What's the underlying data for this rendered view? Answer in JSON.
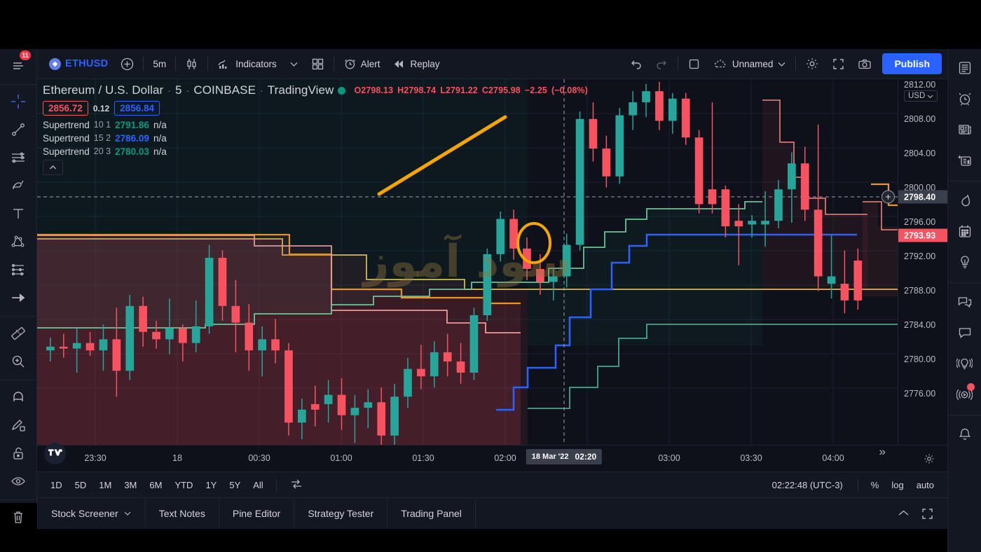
{
  "app": {
    "symbol": "ETHUSD",
    "timeframe": "5m",
    "indicators_label": "Indicators",
    "alert_label": "Alert",
    "replay_label": "Replay",
    "layout_name": "Unnamed",
    "publish_label": "Publish"
  },
  "legend": {
    "title": "Ethereum / U.S. Dollar",
    "interval": "5",
    "exchange": "COINBASE",
    "provider": "TradingView",
    "ohlc": {
      "o_label": "O",
      "o": "2798.13",
      "h_label": "H",
      "h": "2798.74",
      "l_label": "L",
      "l": "2791.22",
      "c_label": "C",
      "c": "2795.98",
      "change": "−2.25",
      "change_pct": "(−0.08%)"
    },
    "pricebox": {
      "bid": "2856.72",
      "spread": "0.12",
      "ask": "2856.84"
    },
    "indicators": [
      {
        "name": "Supertrend",
        "params": "10 1",
        "value": "2791.86",
        "value_color": "#089981",
        "extra": "n/a"
      },
      {
        "name": "Supertrend",
        "params": "15 2",
        "value": "2786.09",
        "value_color": "#2962ff",
        "extra": "n/a"
      },
      {
        "name": "Supertrend",
        "params": "20 3",
        "value": "2780.03",
        "value_color": "#089981",
        "extra": "n/a"
      }
    ]
  },
  "price_axis": {
    "currency": "USD",
    "ticks": [
      "2812.00",
      "2808.00",
      "2804.00",
      "2800.00",
      "2796.00",
      "2792.00",
      "2788.00",
      "2784.00",
      "2780.00",
      "2776.00"
    ],
    "last_price": "2793.93",
    "crosshair_price": "2798.40"
  },
  "time_axis": {
    "ticks": [
      "23:30",
      "18",
      "00:30",
      "01:00",
      "01:30",
      "02:00",
      "03:00",
      "03:30",
      "04:00"
    ],
    "crosshair_date": "18 Mar '22",
    "crosshair_time": "02:20"
  },
  "timeframes": [
    "1D",
    "5D",
    "1M",
    "3M",
    "6M",
    "YTD",
    "1Y",
    "5Y",
    "All"
  ],
  "bottom_bar": {
    "clock": "02:22:48 (UTC-3)",
    "percent": "%",
    "log": "log",
    "auto": "auto"
  },
  "panel_tabs": [
    "Stock Screener",
    "Text Notes",
    "Pine Editor",
    "Strategy Tester",
    "Trading Panel"
  ],
  "watermark": "سود آموز",
  "left_sidebar": {
    "badge": "11",
    "tools": [
      "watchlist-icon",
      "crosshair-icon",
      "trend-line-icon",
      "horizontal-lines-icon",
      "brush-icon",
      "text-icon",
      "patterns-icon",
      "forecast-icon",
      "arrow-icon",
      "measure-icon",
      "zoom-in-icon",
      "magnet-icon",
      "drawing-mode-icon",
      "lock-icon",
      "hide-drawings-icon",
      "trash-icon"
    ]
  },
  "right_sidebar": {
    "tools": [
      "watchlist-panel-icon",
      "alerts-icon",
      "news-icon",
      "data-window-icon",
      "hotlist-icon",
      "calendar-icon",
      "ideas-icon",
      "chat-icon",
      "private-chat-icon",
      "broadcast-icon",
      "stream-icon",
      "notifications-icon"
    ]
  },
  "chart_data": {
    "type": "candlestick",
    "title": "Ethereum / U.S. Dollar · 5 · COINBASE",
    "xlabel": "",
    "ylabel": "USD",
    "ylim": [
      2774.0,
      2813.5
    ],
    "grid": true,
    "up_color": "#26a69a",
    "down_color": "#f7525f",
    "candles": [
      {
        "t": "23:10",
        "o": 2784.2,
        "h": 2785.6,
        "l": 2783.0,
        "c": 2784.6,
        "dir": "up"
      },
      {
        "t": "23:15",
        "o": 2784.6,
        "h": 2786.0,
        "l": 2783.4,
        "c": 2784.4,
        "dir": "down"
      },
      {
        "t": "23:20",
        "o": 2784.4,
        "h": 2786.6,
        "l": 2781.8,
        "c": 2785.0,
        "dir": "up"
      },
      {
        "t": "23:25",
        "o": 2785.0,
        "h": 2786.2,
        "l": 2783.6,
        "c": 2784.2,
        "dir": "down"
      },
      {
        "t": "23:30",
        "o": 2784.2,
        "h": 2787.0,
        "l": 2782.0,
        "c": 2785.4,
        "dir": "up"
      },
      {
        "t": "23:35",
        "o": 2785.4,
        "h": 2788.8,
        "l": 2779.2,
        "c": 2782.0,
        "dir": "down"
      },
      {
        "t": "23:40",
        "o": 2782.0,
        "h": 2790.2,
        "l": 2781.0,
        "c": 2789.0,
        "dir": "up"
      },
      {
        "t": "23:45",
        "o": 2789.0,
        "h": 2790.0,
        "l": 2784.6,
        "c": 2786.2,
        "dir": "down"
      },
      {
        "t": "23:50",
        "o": 2786.2,
        "h": 2787.4,
        "l": 2784.4,
        "c": 2785.4,
        "dir": "down"
      },
      {
        "t": "23:55",
        "o": 2785.4,
        "h": 2789.8,
        "l": 2783.8,
        "c": 2786.6,
        "dir": "up"
      },
      {
        "t": "00:00",
        "o": 2786.6,
        "h": 2787.0,
        "l": 2783.0,
        "c": 2785.0,
        "dir": "down"
      },
      {
        "t": "00:05",
        "o": 2785.0,
        "h": 2789.6,
        "l": 2784.0,
        "c": 2786.8,
        "dir": "up"
      },
      {
        "t": "00:10",
        "o": 2786.8,
        "h": 2795.6,
        "l": 2786.0,
        "c": 2794.2,
        "dir": "up"
      },
      {
        "t": "00:15",
        "o": 2794.2,
        "h": 2795.0,
        "l": 2787.4,
        "c": 2789.0,
        "dir": "down"
      },
      {
        "t": "00:20",
        "o": 2789.0,
        "h": 2791.8,
        "l": 2784.0,
        "c": 2787.2,
        "dir": "down"
      },
      {
        "t": "00:25",
        "o": 2787.2,
        "h": 2789.2,
        "l": 2782.0,
        "c": 2784.2,
        "dir": "down"
      },
      {
        "t": "00:30",
        "o": 2784.2,
        "h": 2786.8,
        "l": 2781.4,
        "c": 2785.4,
        "dir": "up"
      },
      {
        "t": "00:35",
        "o": 2785.4,
        "h": 2787.6,
        "l": 2782.8,
        "c": 2784.2,
        "dir": "down"
      },
      {
        "t": "00:40",
        "o": 2784.2,
        "h": 2785.0,
        "l": 2775.0,
        "c": 2776.4,
        "dir": "down"
      },
      {
        "t": "00:45",
        "o": 2776.4,
        "h": 2779.0,
        "l": 2774.6,
        "c": 2777.8,
        "dir": "up"
      },
      {
        "t": "00:50",
        "o": 2777.8,
        "h": 2780.4,
        "l": 2776.0,
        "c": 2778.4,
        "dir": "down"
      },
      {
        "t": "00:55",
        "o": 2778.4,
        "h": 2781.0,
        "l": 2776.4,
        "c": 2779.4,
        "dir": "up"
      },
      {
        "t": "01:00",
        "o": 2779.4,
        "h": 2781.2,
        "l": 2775.6,
        "c": 2777.2,
        "dir": "down"
      },
      {
        "t": "01:05",
        "o": 2777.2,
        "h": 2779.4,
        "l": 2774.2,
        "c": 2778.0,
        "dir": "up"
      },
      {
        "t": "01:10",
        "o": 2778.0,
        "h": 2780.0,
        "l": 2775.8,
        "c": 2778.6,
        "dir": "up"
      },
      {
        "t": "01:15",
        "o": 2778.6,
        "h": 2780.2,
        "l": 2773.0,
        "c": 2775.0,
        "dir": "down"
      },
      {
        "t": "01:20",
        "o": 2775.0,
        "h": 2780.6,
        "l": 2774.0,
        "c": 2779.2,
        "dir": "up"
      },
      {
        "t": "01:25",
        "o": 2779.2,
        "h": 2783.4,
        "l": 2778.0,
        "c": 2782.2,
        "dir": "up"
      },
      {
        "t": "01:30",
        "o": 2782.2,
        "h": 2784.8,
        "l": 2780.0,
        "c": 2781.4,
        "dir": "down"
      },
      {
        "t": "01:35",
        "o": 2781.4,
        "h": 2785.2,
        "l": 2780.2,
        "c": 2784.0,
        "dir": "up"
      },
      {
        "t": "01:40",
        "o": 2784.0,
        "h": 2786.0,
        "l": 2781.4,
        "c": 2783.0,
        "dir": "down"
      },
      {
        "t": "01:45",
        "o": 2783.0,
        "h": 2785.0,
        "l": 2780.6,
        "c": 2781.8,
        "dir": "down"
      },
      {
        "t": "01:50",
        "o": 2781.8,
        "h": 2788.8,
        "l": 2781.0,
        "c": 2788.0,
        "dir": "up"
      },
      {
        "t": "01:55",
        "o": 2788.0,
        "h": 2795.2,
        "l": 2787.4,
        "c": 2794.6,
        "dir": "up"
      },
      {
        "t": "02:00",
        "o": 2794.6,
        "h": 2799.2,
        "l": 2793.8,
        "c": 2798.4,
        "dir": "up"
      },
      {
        "t": "02:05",
        "o": 2798.4,
        "h": 2799.4,
        "l": 2794.0,
        "c": 2795.2,
        "dir": "down"
      },
      {
        "t": "02:10",
        "o": 2795.2,
        "h": 2796.4,
        "l": 2791.8,
        "c": 2793.0,
        "dir": "down"
      },
      {
        "t": "02:15",
        "o": 2793.0,
        "h": 2794.6,
        "l": 2790.2,
        "c": 2791.6,
        "dir": "down"
      },
      {
        "t": "02:20",
        "o": 2791.6,
        "h": 2793.0,
        "l": 2789.6,
        "c": 2792.2,
        "dir": "up"
      },
      {
        "t": "02:25",
        "o": 2792.2,
        "h": 2796.8,
        "l": 2791.0,
        "c": 2795.6,
        "dir": "up"
      },
      {
        "t": "02:30",
        "o": 2795.6,
        "h": 2810.0,
        "l": 2795.0,
        "c": 2809.2,
        "dir": "up"
      },
      {
        "t": "02:35",
        "o": 2809.2,
        "h": 2811.0,
        "l": 2804.6,
        "c": 2806.0,
        "dir": "down"
      },
      {
        "t": "02:40",
        "o": 2806.0,
        "h": 2807.4,
        "l": 2801.8,
        "c": 2803.0,
        "dir": "down"
      },
      {
        "t": "02:45",
        "o": 2803.0,
        "h": 2810.4,
        "l": 2802.2,
        "c": 2809.6,
        "dir": "up"
      },
      {
        "t": "02:50",
        "o": 2809.6,
        "h": 2812.2,
        "l": 2808.0,
        "c": 2811.0,
        "dir": "up"
      },
      {
        "t": "02:55",
        "o": 2811.0,
        "h": 2813.0,
        "l": 2809.4,
        "c": 2812.2,
        "dir": "up"
      },
      {
        "t": "03:00",
        "o": 2812.2,
        "h": 2813.2,
        "l": 2808.0,
        "c": 2809.0,
        "dir": "down"
      },
      {
        "t": "03:05",
        "o": 2809.0,
        "h": 2812.0,
        "l": 2807.6,
        "c": 2811.4,
        "dir": "up"
      },
      {
        "t": "03:10",
        "o": 2811.4,
        "h": 2812.0,
        "l": 2806.4,
        "c": 2807.2,
        "dir": "down"
      },
      {
        "t": "03:15",
        "o": 2807.2,
        "h": 2808.0,
        "l": 2799.0,
        "c": 2800.0,
        "dir": "down"
      },
      {
        "t": "03:20",
        "o": 2800.0,
        "h": 2811.0,
        "l": 2799.0,
        "c": 2801.6,
        "dir": "down"
      },
      {
        "t": "03:25",
        "o": 2801.6,
        "h": 2802.0,
        "l": 2796.4,
        "c": 2797.6,
        "dir": "down"
      },
      {
        "t": "03:30",
        "o": 2797.6,
        "h": 2800.0,
        "l": 2793.4,
        "c": 2798.2,
        "dir": "down"
      },
      {
        "t": "03:35",
        "o": 2798.2,
        "h": 2798.8,
        "l": 2796.4,
        "c": 2797.8,
        "dir": "up"
      },
      {
        "t": "03:40",
        "o": 2797.8,
        "h": 2801.4,
        "l": 2795.4,
        "c": 2798.2,
        "dir": "up"
      },
      {
        "t": "03:45",
        "o": 2798.2,
        "h": 2802.6,
        "l": 2797.4,
        "c": 2801.6,
        "dir": "up"
      },
      {
        "t": "03:50",
        "o": 2801.6,
        "h": 2805.6,
        "l": 2798.0,
        "c": 2804.4,
        "dir": "up"
      },
      {
        "t": "03:55",
        "o": 2804.4,
        "h": 2806.2,
        "l": 2798.2,
        "c": 2799.4,
        "dir": "down"
      },
      {
        "t": "04:00",
        "o": 2799.4,
        "h": 2808.6,
        "l": 2790.6,
        "c": 2792.2,
        "dir": "down"
      },
      {
        "t": "04:05",
        "o": 2792.2,
        "h": 2796.6,
        "l": 2789.8,
        "c": 2791.4,
        "dir": "up"
      },
      {
        "t": "04:10",
        "o": 2791.4,
        "h": 2795.0,
        "l": 2788.2,
        "c": 2789.6,
        "dir": "down"
      },
      {
        "t": "04:15",
        "o": 2789.6,
        "h": 2795.2,
        "l": 2788.6,
        "c": 2793.9,
        "dir": "down"
      }
    ],
    "annotations": [
      {
        "type": "trend-line",
        "color": "#f7a600",
        "label": "rising-trend-line"
      },
      {
        "type": "ellipse",
        "color": "#f7a600",
        "label": "highlight-circle"
      }
    ],
    "supertrend_lines": [
      {
        "name": "Supertrend 10 1",
        "bullish_color": "#089981",
        "bearish_color": "#f7525f"
      },
      {
        "name": "Supertrend 15 2",
        "bullish_color": "#2962ff",
        "bearish_color": "#f7525f"
      },
      {
        "name": "Supertrend 20 3",
        "bullish_color": "#089981",
        "bearish_color": "#e8a33d"
      }
    ]
  }
}
